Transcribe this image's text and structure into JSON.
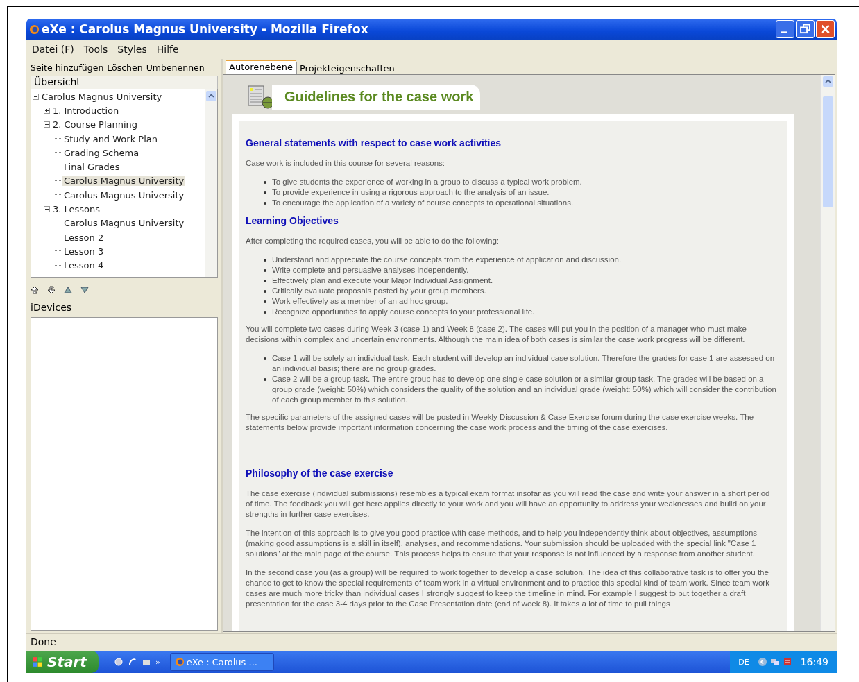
{
  "window": {
    "title": "eXe : Carolus Magnus University - Mozilla Firefox"
  },
  "menu": [
    "Datei (F)",
    "Tools",
    "Styles",
    "Hilfe"
  ],
  "outline_toolbar": [
    "Seite hinzufügen",
    "Löschen",
    "Umbenennen"
  ],
  "outline": {
    "title": "Übersicht",
    "items": [
      {
        "label": "Carolus Magnus University",
        "expanded": true,
        "selected": false,
        "children": [
          {
            "label": "1. Introduction",
            "expanded": false,
            "selected": false
          },
          {
            "label": "2. Course Planning",
            "expanded": true,
            "selected": false,
            "children": [
              {
                "label": "Study and Work Plan",
                "selected": false
              },
              {
                "label": "Grading Schema",
                "selected": false
              },
              {
                "label": "Final Grades",
                "selected": false
              },
              {
                "label": "Carolus Magnus University",
                "selected": true
              },
              {
                "label": "Carolus Magnus University",
                "selected": false
              }
            ]
          },
          {
            "label": "3. Lessons",
            "expanded": true,
            "selected": false,
            "children": [
              {
                "label": "Carolus Magnus University",
                "selected": false
              },
              {
                "label": "Lesson 2",
                "selected": false
              },
              {
                "label": "Lesson 3",
                "selected": false
              },
              {
                "label": "Lesson 4",
                "selected": false
              }
            ]
          }
        ]
      }
    ]
  },
  "idevices": {
    "title": "iDevices"
  },
  "tabs": [
    {
      "label": "Autorenebene",
      "selected": true
    },
    {
      "label": "Projekteigenschaften",
      "selected": false
    }
  ],
  "page": {
    "title": "Guidelines for the case work",
    "blocks": [
      {
        "kind": "heading",
        "text": "General statements with respect to case work activities"
      },
      {
        "kind": "paragraph",
        "text": "Case work is included in this course for several reasons:"
      },
      {
        "kind": "list",
        "items": [
          "To give students the experience of working in a group to discuss a typical work problem.",
          "To provide experience in using a rigorous approach to the analysis of an issue.",
          "To encourage the application of a variety of course concepts to operational situations."
        ]
      },
      {
        "kind": "heading",
        "text": "Learning Objectives"
      },
      {
        "kind": "paragraph",
        "text": "After completing the required cases, you will be able to do the following:"
      },
      {
        "kind": "list",
        "items": [
          "Understand and appreciate the course concepts from the experience of application and discussion.",
          "Write complete and persuasive analyses independently.",
          "Effectively plan and execute your Major Individual Assignment.",
          "Critically evaluate proposals posted by your group members.",
          "Work effectively as a member of an ad hoc group.",
          "Recognize opportunities to apply course concepts to your professional life."
        ]
      },
      {
        "kind": "paragraph",
        "text": "You will complete two cases during Week 3 (case 1) and Week 8 (case 2). The cases will put you in the position of a manager who must make decisions within complex and uncertain environments. Although the main idea of both cases is similar the case work progress will be different."
      },
      {
        "kind": "list",
        "items": [
          "Case 1 will be solely an individual task. Each student will develop an individual case solution. Therefore the grades for case 1 are assessed on an individual basis; there are no group grades.",
          "Case 2 will be a group task. The entire group has to develop one single case solution or a similar group task. The grades will be based on a group grade (weight: 50%) which considers the quality of the solution and an individual grade (weight: 50%) which will consider the contribution of each group member to this solution."
        ]
      },
      {
        "kind": "paragraph",
        "text": "The specific parameters of the assigned cases will be posted in Weekly Discussion & Case Exercise forum during the case exercise weeks. The statements below provide important information concerning the case work process and the timing of the case exercises."
      },
      {
        "kind": "heading",
        "text": "Philosophy of the case exercise"
      },
      {
        "kind": "paragraph",
        "text": "The case exercise (individual submissions) resembles a typical exam format insofar as you will read the case and write your answer in a short period of time. The feedback you will get here applies directly to your work and you will have an opportunity to address your weaknesses and build on your strengths in further case exercises."
      },
      {
        "kind": "paragraph",
        "text": "The intention of this approach is to give you good practice with case methods, and to help you independently think about objectives, assumptions (making good assumptions is a skill in itself), analyses, and recommendations. Your submission should be uploaded with the special link \"Case 1 solutions\" at the main page of the course. This process helps to ensure that your response is not influenced by a response from another student."
      },
      {
        "kind": "paragraph",
        "text": "In the second case you (as a group) will be required to work together to develop a case solution. The idea of this collaborative task is to offer you the chance to get to know the special requirements of team work in a virtual environment and to practice this special kind of team work. Since team work cases are much more tricky than individual cases I strongly suggest to keep the timeline in mind. For example I suggest to put together a draft presentation for the case 3-4 days prior to the Case Presentation date (end of week 8). It takes a lot of time to pull things"
      }
    ]
  },
  "status_bar": "Done",
  "taskbar": {
    "start": "Start",
    "quick_launch_more": "»",
    "task": "eXe : Carolus ...",
    "language": "DE",
    "clock": "16:49"
  }
}
